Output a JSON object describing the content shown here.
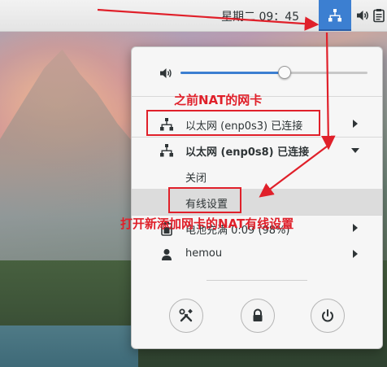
{
  "topbar": {
    "clock": "星期二 09：45"
  },
  "menu": {
    "volume_percent": 55,
    "networks": [
      {
        "label": "以太网 (enp0s3) 已连接"
      },
      {
        "label": "以太网 (enp0s8) 已连接",
        "expanded": true
      }
    ],
    "submenu": {
      "off_label": "关闭",
      "wired_settings_label": "有线设置"
    },
    "battery_label": "电池充满 0:09 (98%)",
    "user_label": "hemou"
  },
  "annotations": {
    "previous_nic": "之前NAT的网卡",
    "open_new_nic": "打开新添加网卡的NAT有线设置"
  },
  "colors": {
    "accent": "#3c7fd1",
    "annotation_red": "#e0202a"
  }
}
